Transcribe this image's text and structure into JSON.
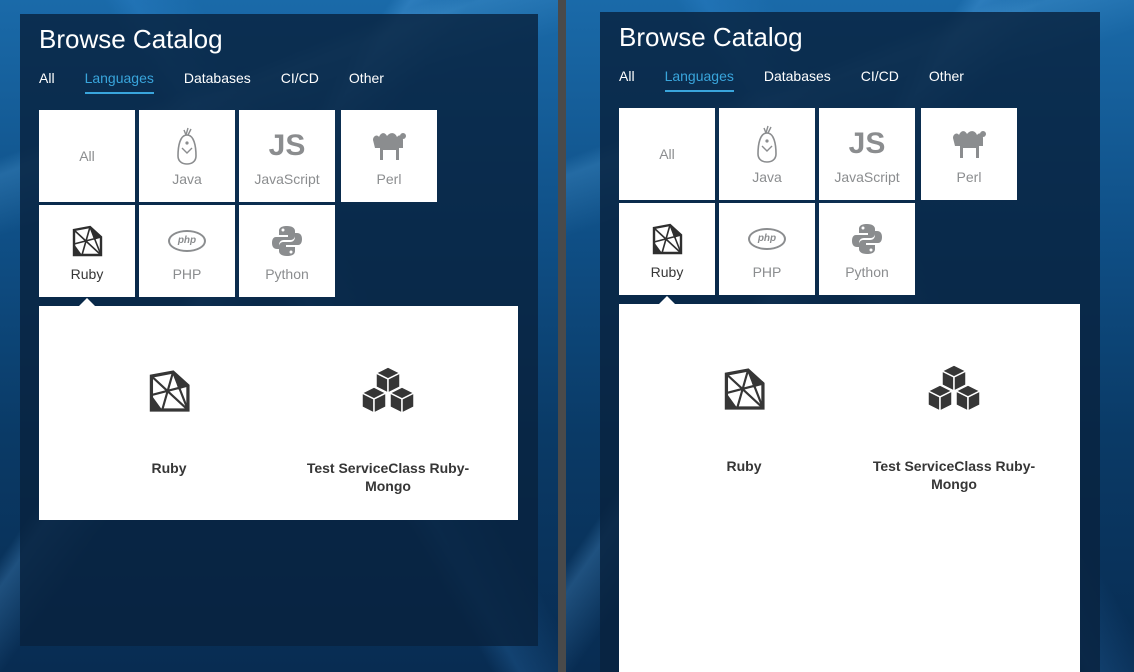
{
  "panels": [
    {
      "title": "Browse Catalog",
      "tabs": [
        "All",
        "Languages",
        "Databases",
        "CI/CD",
        "Other"
      ],
      "active_tab": "Languages",
      "tiles": [
        {
          "label": "All",
          "icon": "none"
        },
        {
          "label": "Java",
          "icon": "java-icon"
        },
        {
          "label": "JavaScript",
          "icon": "js-icon"
        },
        {
          "label": "Perl",
          "icon": "camel-icon"
        },
        {
          "label": "Ruby",
          "icon": "ruby-icon",
          "selected": true
        },
        {
          "label": "PHP",
          "icon": "php-icon"
        },
        {
          "label": "Python",
          "icon": "python-icon"
        }
      ],
      "js_text": "JS",
      "php_text": "php",
      "items": [
        {
          "label": "Ruby",
          "icon": "ruby-icon"
        },
        {
          "label": "Test ServiceClass Ruby-\nMongo",
          "icon": "cubes-icon"
        }
      ]
    },
    {
      "title": "Browse Catalog",
      "tabs": [
        "All",
        "Languages",
        "Databases",
        "CI/CD",
        "Other"
      ],
      "active_tab": "Languages",
      "tiles": [
        {
          "label": "All",
          "icon": "none"
        },
        {
          "label": "Java",
          "icon": "java-icon"
        },
        {
          "label": "JavaScript",
          "icon": "js-icon"
        },
        {
          "label": "Perl",
          "icon": "camel-icon"
        },
        {
          "label": "Ruby",
          "icon": "ruby-icon",
          "selected": true
        },
        {
          "label": "PHP",
          "icon": "php-icon"
        },
        {
          "label": "Python",
          "icon": "python-icon"
        }
      ],
      "js_text": "JS",
      "php_text": "php",
      "items": [
        {
          "label": "Ruby",
          "icon": "ruby-icon"
        },
        {
          "label": "Test ServiceClass Ruby-\nMongo",
          "icon": "cubes-icon"
        }
      ]
    }
  ],
  "colors": {
    "accent": "#39a5dc",
    "panel_bg": "#08223e",
    "tile_bg": "#ffffff",
    "muted_text": "#8b8d8f",
    "dark_text": "#363636"
  }
}
